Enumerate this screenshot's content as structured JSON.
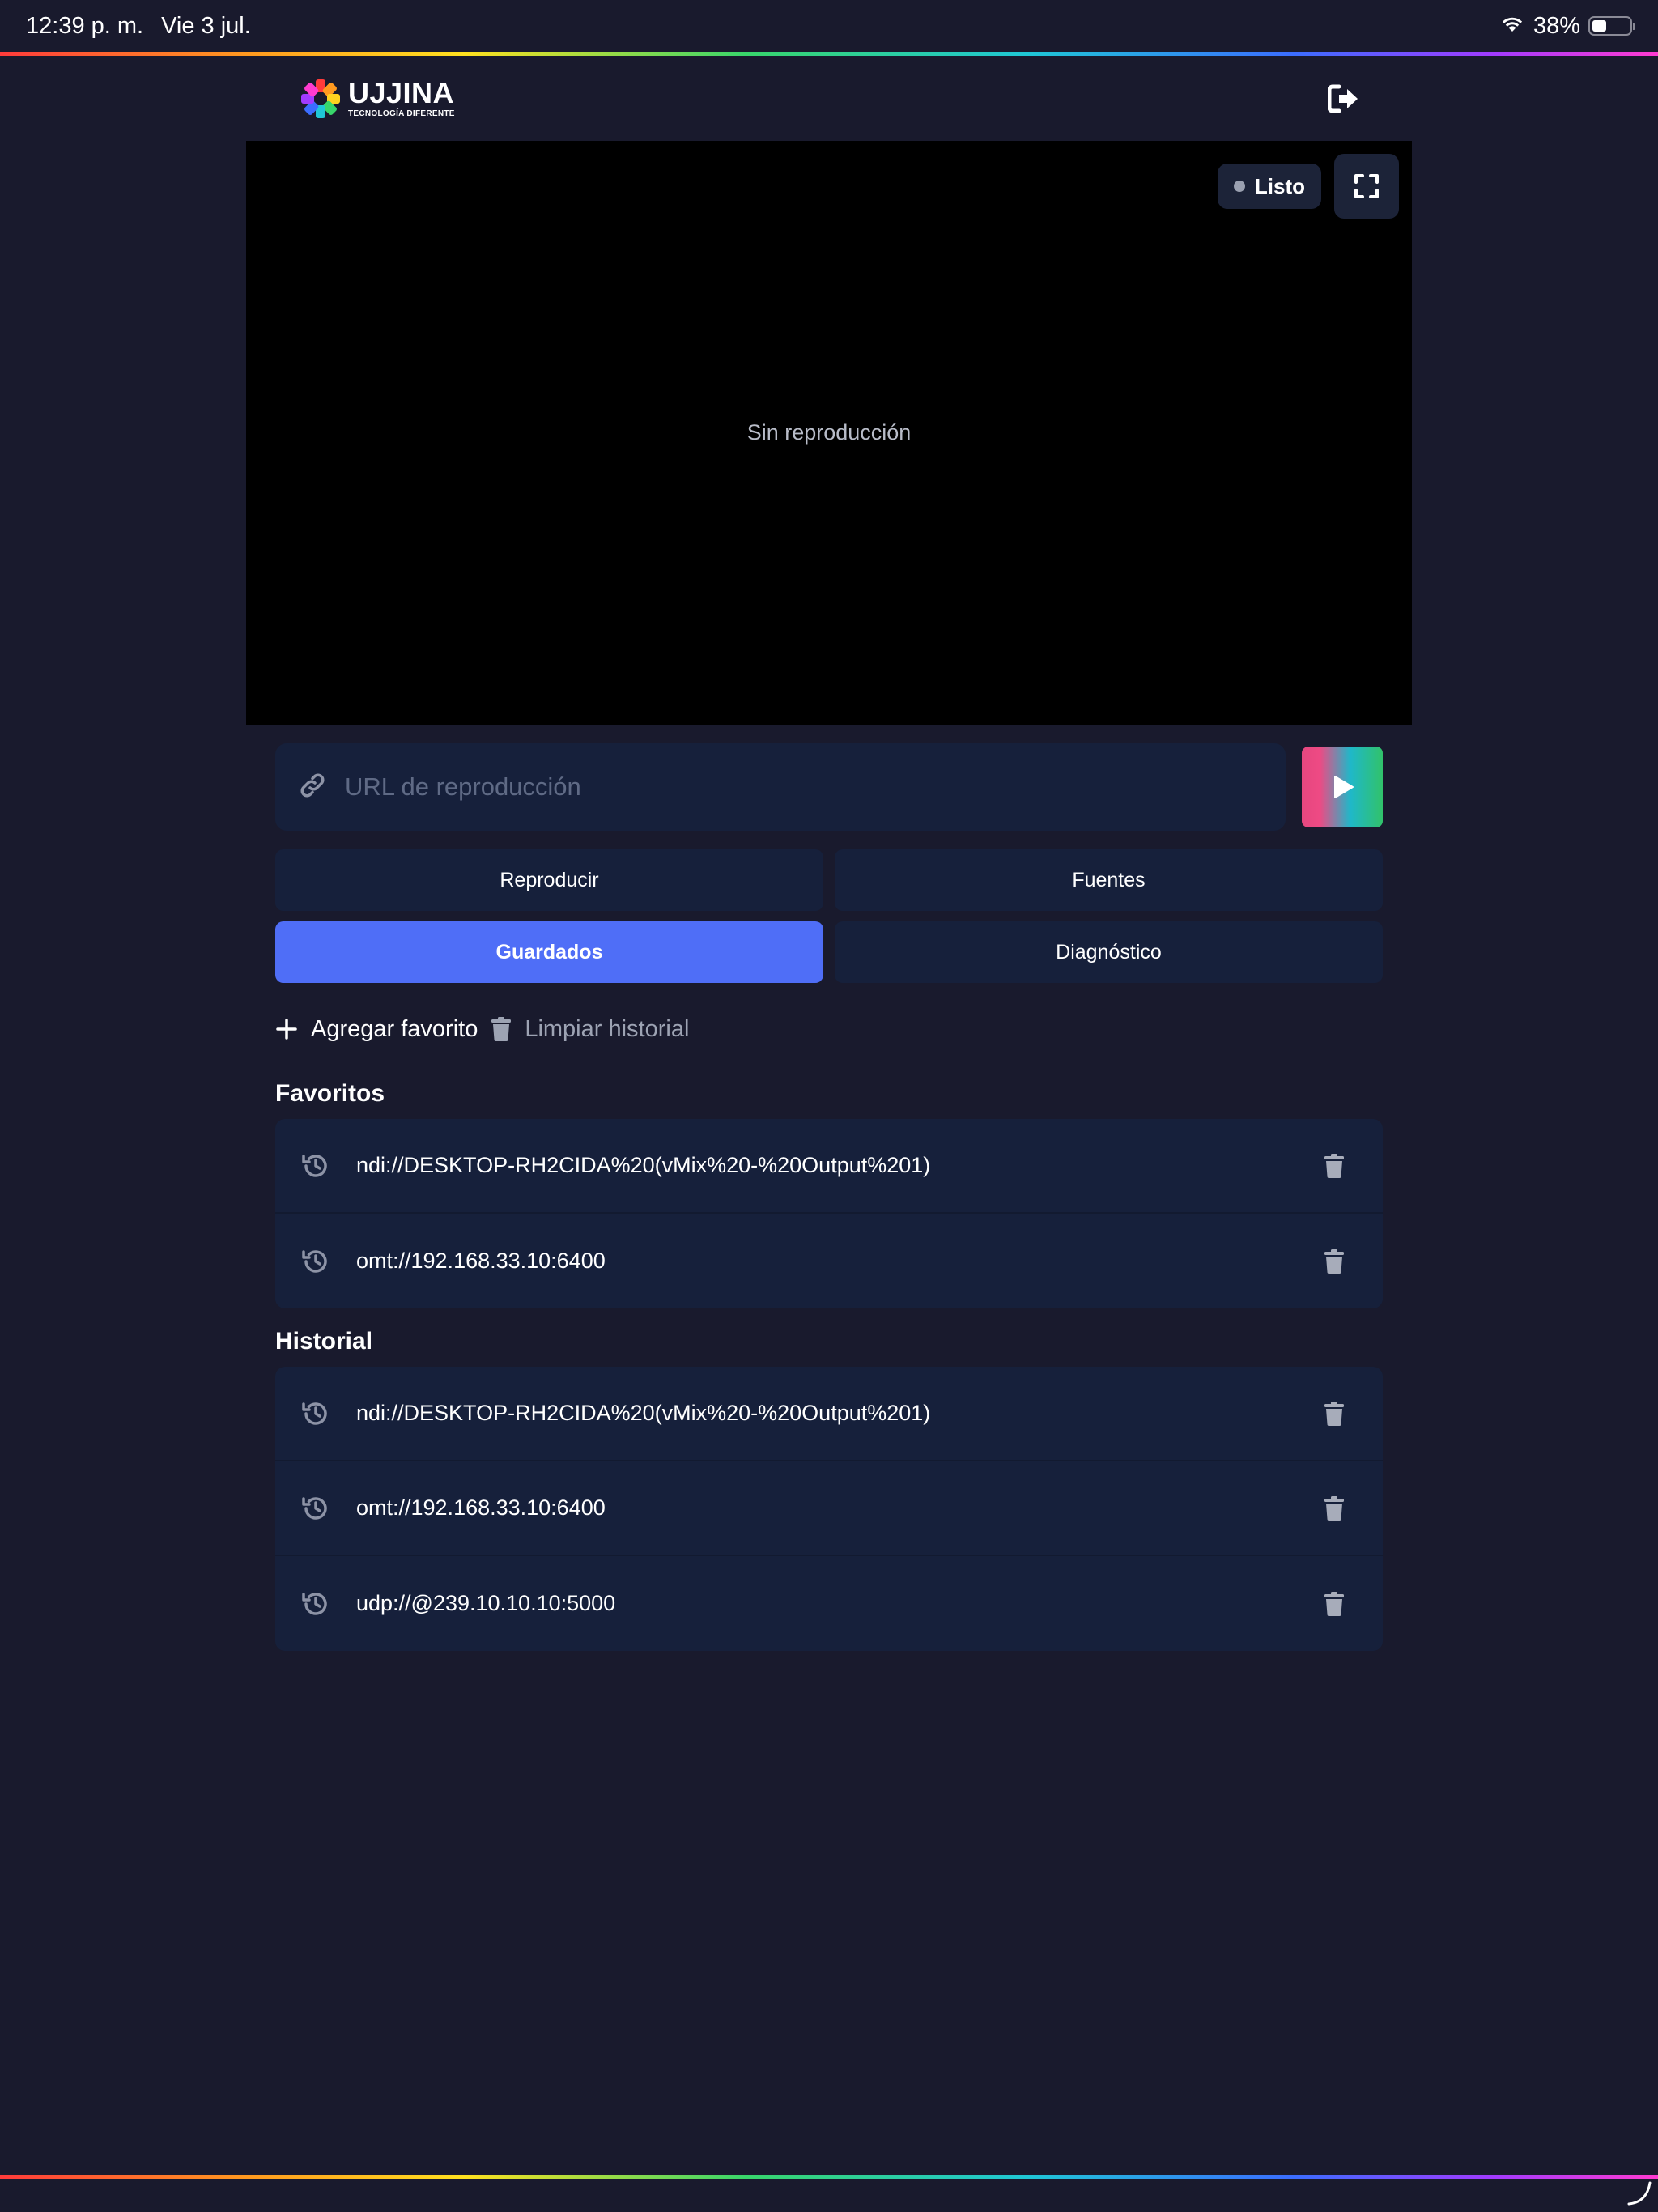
{
  "status_bar": {
    "time": "12:39 p. m.",
    "date": "Vie 3 jul.",
    "battery": "38%",
    "battery_level": 0.38
  },
  "header": {
    "logo_title": "UJJINA",
    "logo_subtitle": "TECNOLOGÍA DIFERENTE",
    "logout_icon": "logout-icon"
  },
  "player": {
    "status_label": "Listo",
    "placeholder_text": "Sin reproducción",
    "fullscreen_icon": "fullscreen-icon"
  },
  "url_input": {
    "placeholder": "URL de reproducción",
    "value": "",
    "link_icon": "link-icon",
    "play_icon": "play-icon"
  },
  "tabs": [
    {
      "label": "Reproducir",
      "active": false
    },
    {
      "label": "Fuentes",
      "active": false
    },
    {
      "label": "Guardados",
      "active": true
    },
    {
      "label": "Diagnóstico",
      "active": false
    }
  ],
  "actions": {
    "add_favorite": "Agregar favorito",
    "clear_history": "Limpiar historial"
  },
  "favorites": {
    "title": "Favoritos",
    "items": [
      "ndi://DESKTOP-RH2CIDA%20(vMix%20-%20Output%201)",
      "omt://192.168.33.10:6400"
    ]
  },
  "history": {
    "title": "Historial",
    "items": [
      "ndi://DESKTOP-RH2CIDA%20(vMix%20-%20Output%201)",
      "omt://192.168.33.10:6400",
      "udp://@239.10.10.10:5000"
    ]
  },
  "colors": {
    "background": "#191a2d",
    "panel": "#16203b",
    "accent": "#4f6ef7"
  }
}
